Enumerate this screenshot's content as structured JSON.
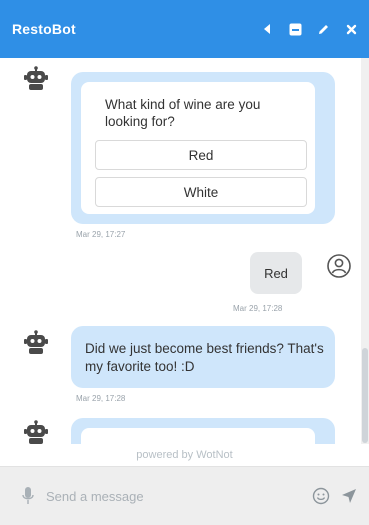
{
  "header": {
    "title": "RestoBot",
    "icons": [
      "back-arrow-icon",
      "minimize-icon",
      "edit-icon",
      "close-icon"
    ]
  },
  "conversation": {
    "question": {
      "text": "What kind of wine are you looking for?",
      "options": [
        "Red",
        "White"
      ],
      "timestamp": "Mar 29, 17:27"
    },
    "user_reply": {
      "text": "Red",
      "timestamp": "Mar 29, 17:28"
    },
    "bot_reply": {
      "text": "Did we just become best friends? That's my favorite too! :D",
      "timestamp": "Mar 29, 17:28"
    }
  },
  "footer": {
    "powered_by": "powered by WotNot"
  },
  "composer": {
    "placeholder": "Send a message"
  },
  "colors": {
    "header": "#2f8fe6",
    "bot_bubble": "#cfe6fb",
    "user_bubble": "#e6e8ea",
    "composer_bg": "#eeeeee"
  }
}
